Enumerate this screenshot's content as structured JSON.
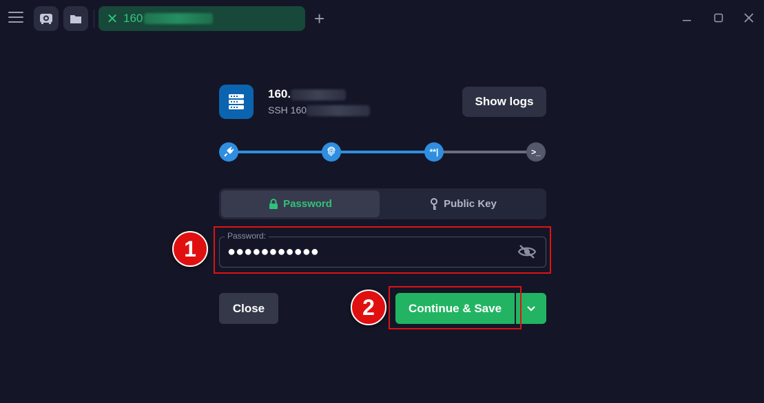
{
  "titlebar": {
    "tab_label": "160",
    "window_controls": {
      "minimize": "—",
      "maximize": "☐",
      "close": "✕"
    }
  },
  "host": {
    "title": "160.",
    "subtitle": "SSH 160",
    "show_logs_label": "Show logs"
  },
  "progress": {
    "steps": [
      {
        "icon": "plug-icon",
        "state": "done"
      },
      {
        "icon": "fingerprint-icon",
        "state": "done"
      },
      {
        "icon": "password-cursor-icon",
        "label": "**|",
        "state": "active"
      },
      {
        "icon": "terminal-icon",
        "label": ">_",
        "state": "pending"
      }
    ]
  },
  "auth": {
    "password_tab": "Password",
    "public_key_tab": "Public Key",
    "selected": "Password"
  },
  "password_field": {
    "label": "Password:",
    "masked_value": "●●●●●●●●●●●"
  },
  "actions": {
    "close_label": "Close",
    "continue_label": "Continue & Save"
  },
  "annotations": {
    "badge_1": "1",
    "badge_2": "2"
  },
  "colors": {
    "background": "#141627",
    "accent_blue": "#2f8ee0",
    "accent_green": "#22b462",
    "tab_green": "#17483a",
    "highlight_red": "#e01212"
  }
}
